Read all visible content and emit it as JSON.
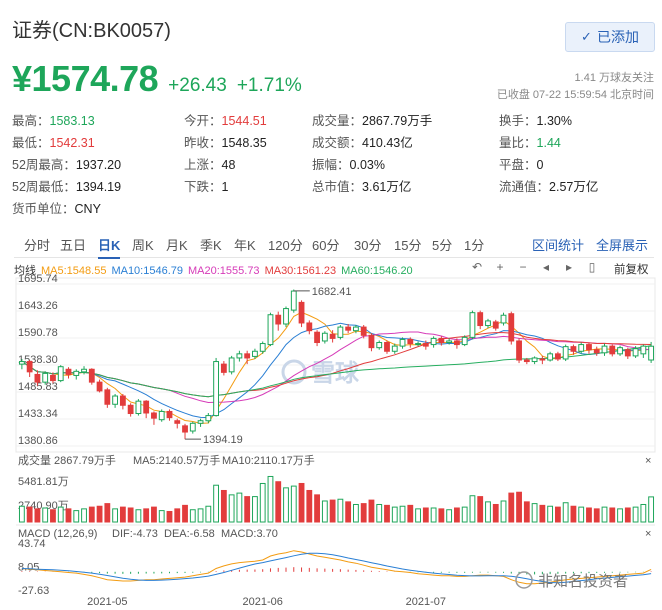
{
  "header": {
    "title": "证券(CN:BK0057)",
    "add_button": "已添加",
    "price": "¥1574.78",
    "change": "+26.43",
    "change_pct": "+1.71%",
    "followers": "1.41 万球友关注",
    "status_time": "已收盘 07-22 15:59:54 北京时间"
  },
  "stats": [
    {
      "label": "最高：",
      "value": "1583.13",
      "color": "down",
      "col": 0,
      "row": 0
    },
    {
      "label": "今开：",
      "value": "1544.51",
      "color": "up",
      "col": 1,
      "row": 0
    },
    {
      "label": "成交量：",
      "value": "2867.79万手",
      "color": "",
      "col": 2,
      "row": 0
    },
    {
      "label": "换手：",
      "value": "1.30%",
      "color": "",
      "col": 3,
      "row": 0
    },
    {
      "label": "最低：",
      "value": "1542.31",
      "color": "up",
      "col": 0,
      "row": 1
    },
    {
      "label": "昨收：",
      "value": "1548.35",
      "color": "",
      "col": 1,
      "row": 1
    },
    {
      "label": "成交额：",
      "value": "410.43亿",
      "color": "",
      "col": 2,
      "row": 1
    },
    {
      "label": "量比：",
      "value": "1.44",
      "color": "down",
      "col": 3,
      "row": 1
    },
    {
      "label": "52周最高：",
      "value": "1937.20",
      "color": "",
      "col": 0,
      "row": 2
    },
    {
      "label": "上涨：",
      "value": "48",
      "color": "",
      "col": 1,
      "row": 2
    },
    {
      "label": "振幅：",
      "value": "0.03%",
      "color": "",
      "col": 2,
      "row": 2
    },
    {
      "label": "平盘：",
      "value": "0",
      "color": "",
      "col": 3,
      "row": 2
    },
    {
      "label": "52周最低：",
      "value": "1394.19",
      "color": "",
      "col": 0,
      "row": 3
    },
    {
      "label": "下跌：",
      "value": "1",
      "color": "",
      "col": 1,
      "row": 3
    },
    {
      "label": "总市值：",
      "value": "3.61万亿",
      "color": "",
      "col": 2,
      "row": 3
    },
    {
      "label": "流通值：",
      "value": "2.57万亿",
      "color": "",
      "col": 3,
      "row": 3
    },
    {
      "label": "货币单位：",
      "value": "CNY",
      "color": "",
      "col": 0,
      "row": 4
    }
  ],
  "tabs": [
    "分时",
    "五日",
    "日K",
    "周K",
    "月K",
    "季K",
    "年K",
    "120分",
    "60分",
    "30分",
    "15分",
    "5分",
    "1分"
  ],
  "active_tab": "日K",
  "tab_links": [
    "区间统计",
    "全屏展示"
  ],
  "ma_legend": {
    "label": "均线",
    "items": [
      {
        "text": "MA5:1548.55",
        "color": "#f39c12"
      },
      {
        "text": "MA10:1546.79",
        "color": "#2a7fd4"
      },
      {
        "text": "MA20:1555.73",
        "color": "#d63bb8"
      },
      {
        "text": "MA30:1561.23",
        "color": "#e23c3c"
      },
      {
        "text": "MA60:1546.20",
        "color": "#27ae60"
      }
    ]
  },
  "tools": [
    "↶",
    "+",
    "−",
    "◂",
    "▸",
    "▯"
  ],
  "front_adjust": "前复权",
  "volume_legend": {
    "label": "成交量 2867.79万手",
    "ma5": "MA5:2140.57万手",
    "ma10": "MA10:2110.17万手"
  },
  "macd_legend": {
    "label": "MACD (12,26,9)",
    "dif": "DIF:-4.73",
    "dea": "DEA:-6.58",
    "macd": "MACD:3.70"
  },
  "watermark": "雪球",
  "footer_watermark": "非知名投资者",
  "chart_data": {
    "type": "candlestick",
    "price_axis": [
      "1695.74",
      "1643.26",
      "1590.78",
      "1538.30",
      "1485.83",
      "1433.34",
      "1380.86"
    ],
    "price_ylim": [
      1380.86,
      1695.74
    ],
    "annotations": {
      "high": "1682.41",
      "low": "1394.19"
    },
    "volume_axis": [
      "5481.81万",
      "2740.90万"
    ],
    "volume_ylim": [
      0,
      5481.81
    ],
    "macd_axis": [
      "43.74",
      "8.05",
      "-27.63"
    ],
    "macd_ylim": [
      -27.63,
      43.74
    ],
    "x_labels": [
      {
        "text": "2021-05",
        "index": 11
      },
      {
        "text": "2021-06",
        "index": 31
      },
      {
        "text": "2021-07",
        "index": 52
      }
    ],
    "candles": [
      [
        1540,
        1545,
        1530,
        1550
      ],
      [
        1545,
        1525,
        1515,
        1548
      ],
      [
        1520,
        1505,
        1498,
        1528
      ],
      [
        1505,
        1522,
        1500,
        1526
      ],
      [
        1518,
        1508,
        1503,
        1524
      ],
      [
        1508,
        1535,
        1505,
        1538
      ],
      [
        1530,
        1520,
        1512,
        1534
      ],
      [
        1518,
        1526,
        1510,
        1530
      ],
      [
        1525,
        1530,
        1520,
        1536
      ],
      [
        1530,
        1505,
        1500,
        1532
      ],
      [
        1505,
        1488,
        1485,
        1510
      ],
      [
        1490,
        1462,
        1455,
        1494
      ],
      [
        1462,
        1478,
        1455,
        1482
      ],
      [
        1478,
        1460,
        1452,
        1482
      ],
      [
        1460,
        1444,
        1438,
        1464
      ],
      [
        1444,
        1468,
        1440,
        1472
      ],
      [
        1468,
        1445,
        1435,
        1470
      ],
      [
        1445,
        1435,
        1422,
        1448
      ],
      [
        1432,
        1448,
        1428,
        1452
      ],
      [
        1448,
        1436,
        1430,
        1452
      ],
      [
        1430,
        1425,
        1415,
        1434
      ],
      [
        1420,
        1408,
        1394,
        1424
      ],
      [
        1410,
        1425,
        1405,
        1428
      ],
      [
        1425,
        1430,
        1418,
        1434
      ],
      [
        1430,
        1440,
        1425,
        1445
      ],
      [
        1440,
        1545,
        1438,
        1552
      ],
      [
        1540,
        1524,
        1518,
        1546
      ],
      [
        1525,
        1552,
        1520,
        1556
      ],
      [
        1552,
        1560,
        1545,
        1566
      ],
      [
        1560,
        1552,
        1540,
        1566
      ],
      [
        1555,
        1565,
        1550,
        1570
      ],
      [
        1565,
        1580,
        1560,
        1584
      ],
      [
        1578,
        1636,
        1575,
        1640
      ],
      [
        1635,
        1618,
        1605,
        1642
      ],
      [
        1618,
        1648,
        1612,
        1652
      ],
      [
        1645,
        1682,
        1640,
        1685
      ],
      [
        1660,
        1620,
        1612,
        1664
      ],
      [
        1620,
        1605,
        1598,
        1625
      ],
      [
        1602,
        1582,
        1575,
        1606
      ],
      [
        1585,
        1600,
        1580,
        1604
      ],
      [
        1598,
        1590,
        1582,
        1606
      ],
      [
        1592,
        1612,
        1588,
        1616
      ],
      [
        1612,
        1606,
        1600,
        1618
      ],
      [
        1605,
        1612,
        1600,
        1616
      ],
      [
        1612,
        1596,
        1590,
        1616
      ],
      [
        1596,
        1572,
        1565,
        1600
      ],
      [
        1572,
        1582,
        1568,
        1586
      ],
      [
        1582,
        1565,
        1560,
        1586
      ],
      [
        1565,
        1575,
        1560,
        1580
      ],
      [
        1575,
        1588,
        1570,
        1592
      ],
      [
        1588,
        1580,
        1572,
        1592
      ],
      [
        1580,
        1580,
        1575,
        1584
      ],
      [
        1580,
        1575,
        1568,
        1586
      ],
      [
        1578,
        1590,
        1572,
        1594
      ],
      [
        1590,
        1582,
        1576,
        1594
      ],
      [
        1582,
        1585,
        1578,
        1590
      ],
      [
        1585,
        1578,
        1570,
        1590
      ],
      [
        1578,
        1592,
        1575,
        1596
      ],
      [
        1592,
        1640,
        1588,
        1644
      ],
      [
        1640,
        1615,
        1608,
        1644
      ],
      [
        1615,
        1624,
        1610,
        1628
      ],
      [
        1622,
        1610,
        1605,
        1626
      ],
      [
        1620,
        1635,
        1615,
        1640
      ],
      [
        1638,
        1585,
        1578,
        1642
      ],
      [
        1585,
        1548,
        1542,
        1590
      ],
      [
        1548,
        1545,
        1540,
        1552
      ],
      [
        1545,
        1552,
        1540,
        1555
      ],
      [
        1550,
        1548,
        1540,
        1556
      ],
      [
        1548,
        1560,
        1545,
        1564
      ],
      [
        1560,
        1550,
        1546,
        1564
      ],
      [
        1550,
        1574,
        1546,
        1578
      ],
      [
        1574,
        1565,
        1558,
        1578
      ],
      [
        1565,
        1578,
        1560,
        1582
      ],
      [
        1578,
        1568,
        1560,
        1582
      ],
      [
        1568,
        1562,
        1556,
        1574
      ],
      [
        1562,
        1575,
        1556,
        1580
      ],
      [
        1575,
        1560,
        1555,
        1578
      ],
      [
        1560,
        1572,
        1556,
        1576
      ],
      [
        1568,
        1556,
        1550,
        1572
      ],
      [
        1556,
        1570,
        1552,
        1575
      ],
      [
        1560,
        1575,
        1552,
        1578
      ],
      [
        1548,
        1574.78,
        1542.31,
        1583.13
      ]
    ],
    "volumes": [
      1800,
      1700,
      1500,
      1600,
      1400,
      1700,
      1500,
      1300,
      1500,
      1700,
      1800,
      2100,
      1500,
      1700,
      1600,
      1400,
      1500,
      1700,
      1300,
      1200,
      1500,
      1900,
      1400,
      1500,
      1800,
      4200,
      3600,
      3100,
      3300,
      2900,
      2900,
      4400,
      5200,
      4600,
      3900,
      4100,
      4400,
      3600,
      3100,
      2400,
      2500,
      2600,
      2300,
      2000,
      2100,
      2500,
      2000,
      1900,
      1700,
      1800,
      1900,
      1500,
      1600,
      1600,
      1500,
      1400,
      1600,
      1700,
      3000,
      2900,
      2300,
      2000,
      2400,
      3300,
      3400,
      2300,
      2100,
      1900,
      1800,
      1700,
      2200,
      1800,
      1700,
      1600,
      1500,
      1700,
      1600,
      1500,
      1600,
      1700,
      2000,
      2867.79
    ],
    "macd": [
      5,
      4,
      3,
      2,
      1,
      0,
      -1,
      -2,
      -4,
      -6,
      -9,
      -12,
      -13,
      -14,
      -14,
      -13,
      -12,
      -12,
      -11,
      -10,
      -9,
      -8,
      -6,
      -4,
      -2,
      5,
      9,
      12,
      14,
      15,
      16,
      18,
      24,
      27,
      29,
      32,
      30,
      27,
      24,
      22,
      20,
      18,
      15,
      13,
      10,
      7,
      5,
      3,
      1,
      0,
      -1,
      -3,
      -4,
      -5,
      -6,
      -6,
      -7,
      -7,
      -6,
      -5,
      -5,
      -6,
      -7,
      -12,
      -16,
      -18,
      -18,
      -17,
      -16,
      -14,
      -12,
      -11,
      -10,
      -9,
      -8,
      -7,
      -6,
      -5,
      -4,
      -3,
      -2,
      3.7
    ]
  }
}
